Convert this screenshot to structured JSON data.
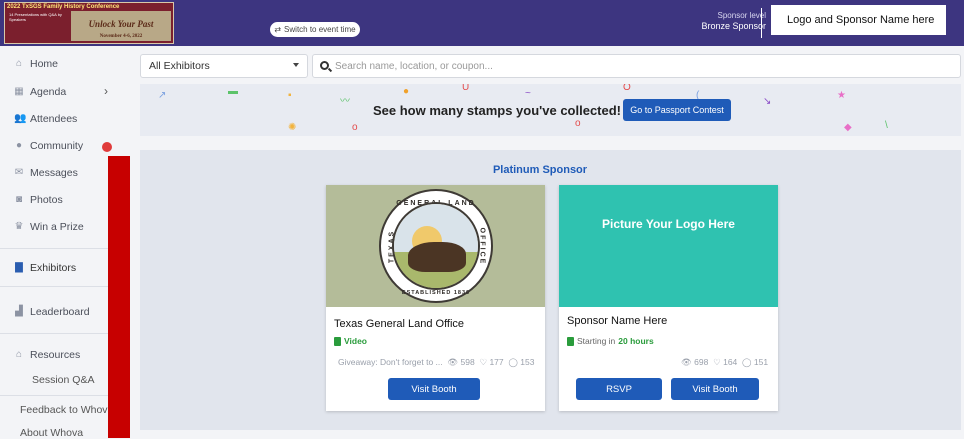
{
  "header": {
    "banner": {
      "line1": "2022 TxSGS Family History Conference",
      "line2": "14 Presentations with Q&A by Speakers",
      "line3": "Unlock Your Past",
      "line4": "November 4-6, 2022"
    },
    "switch_label": "Switch to event time",
    "sponsor_level_label": "Sponsor level",
    "sponsor_level_value": "Bronze Sponsor",
    "sponsor_box": "Logo and Sponsor Name here"
  },
  "sidebar": {
    "items": [
      {
        "label": "Home",
        "icon": "home-icon"
      },
      {
        "label": "Agenda",
        "icon": "calendar-icon"
      },
      {
        "label": "Attendees",
        "icon": "people-icon"
      },
      {
        "label": "Community",
        "icon": "chat-icon"
      },
      {
        "label": "Messages",
        "icon": "envelope-icon"
      },
      {
        "label": "Photos",
        "icon": "camera-icon"
      },
      {
        "label": "Win a Prize",
        "icon": "trophy-icon"
      },
      {
        "label": "Exhibitors",
        "icon": "building-icon"
      },
      {
        "label": "Leaderboard",
        "icon": "bar-chart-icon"
      },
      {
        "label": "Resources",
        "icon": "bank-icon"
      }
    ],
    "session_qa": "Session Q&A",
    "feedback": "Feedback to Whova",
    "about": "About Whova"
  },
  "filter": {
    "selected": "All Exhibitors",
    "search_placeholder": "Search name, location, or coupon..."
  },
  "stamps": {
    "text": "See how many stamps you've collected!",
    "button": "Go to Passport Contest"
  },
  "platinum": {
    "title": "Platinum Sponsor",
    "cards": [
      {
        "name": "Texas General Land Office",
        "tag": "Video",
        "giveaway": "Giveaway: Don't forget to ...",
        "views": "598",
        "likes": "177",
        "comments": "153",
        "seal_top": "GENERAL LAND",
        "seal_left": "TEXAS",
        "seal_right": "OFFICE",
        "seal_bottom": "ESTABLISHED 1836",
        "button": "Visit Booth"
      },
      {
        "name": "Sponsor Name Here",
        "image_text": "Picture Your Logo Here",
        "tag_prefix": "Starting in",
        "tag_time": "20 hours",
        "views": "698",
        "likes": "164",
        "comments": "151",
        "rsvp": "RSVP",
        "button": "Visit Booth"
      }
    ]
  },
  "colors": {
    "header": "#3d3580",
    "primary": "#1f5bb8",
    "logo_teal": "#2fc2b0",
    "green": "#2a9c3c"
  }
}
